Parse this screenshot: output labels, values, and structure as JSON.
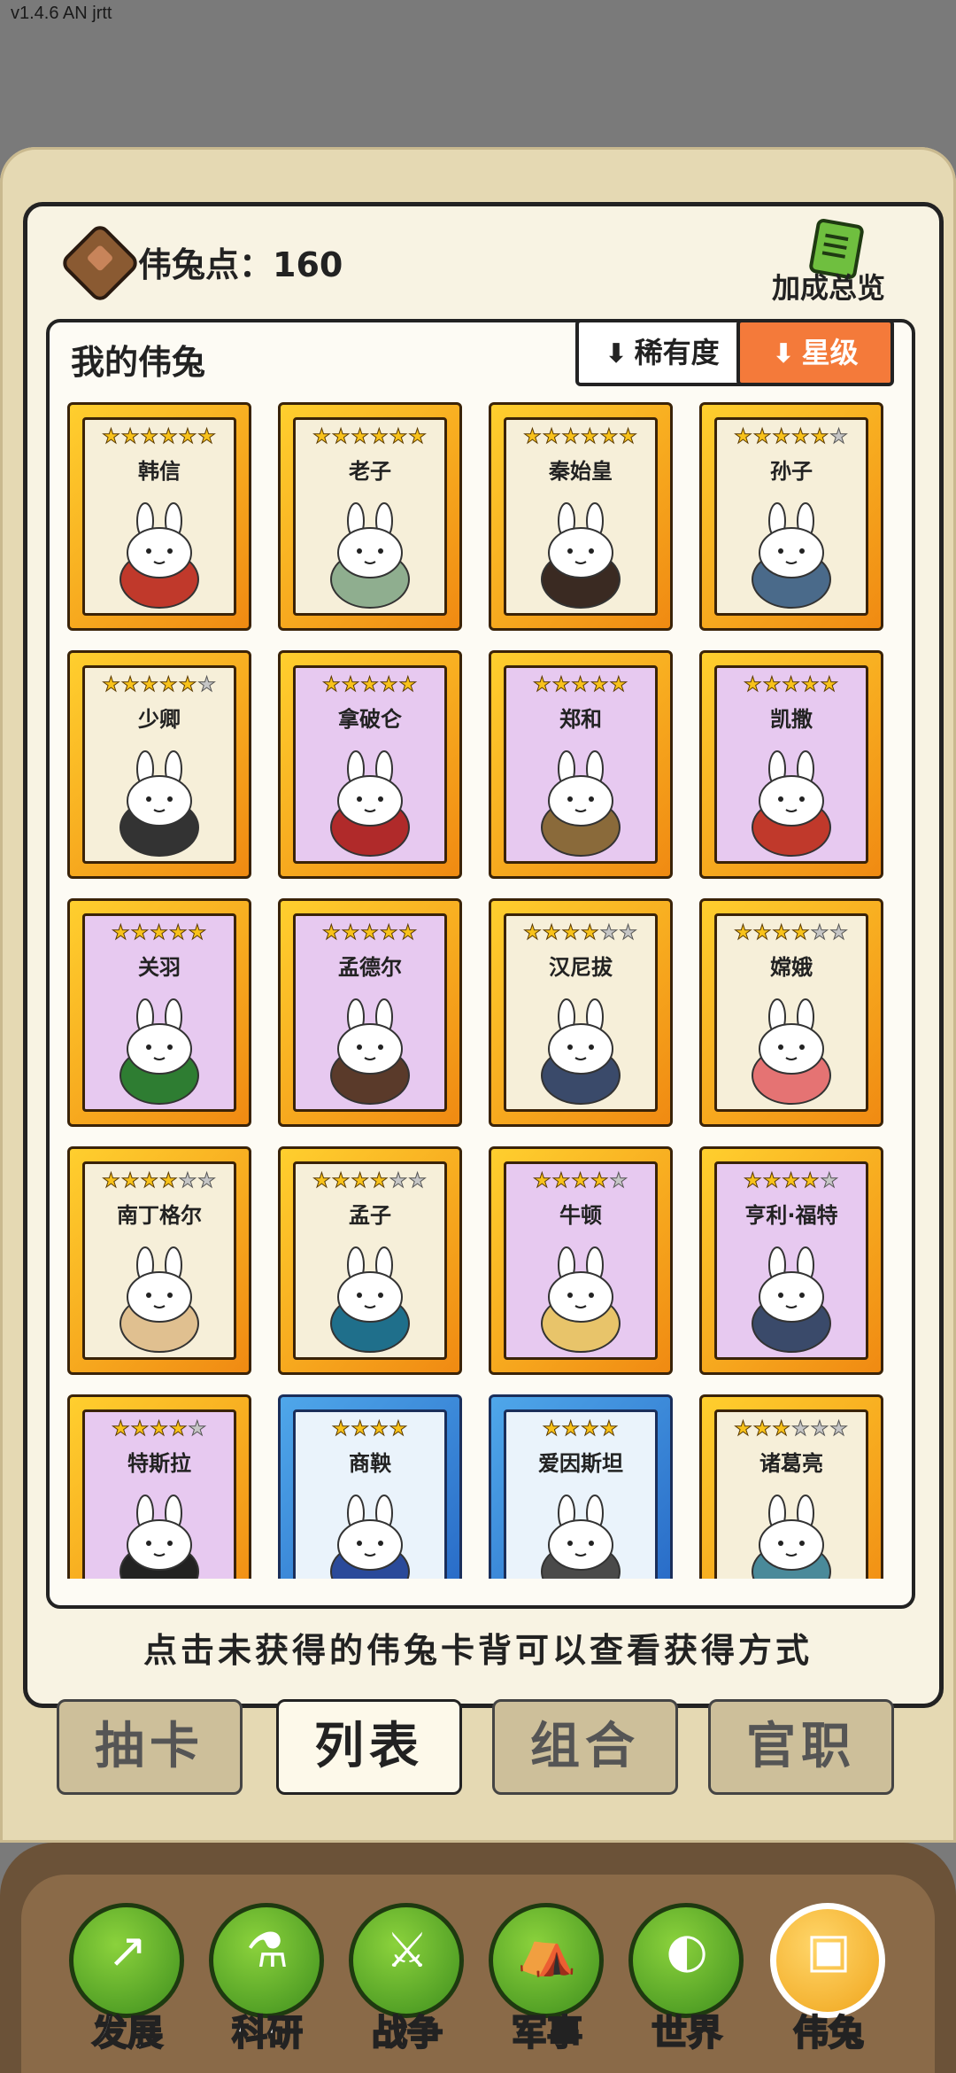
{
  "version": "v1.4.6 AN jrtt",
  "header": {
    "points_label": "伟兔点：160",
    "bonus_label": "加成总览"
  },
  "section_title": "我的伟兔",
  "sort": {
    "rarity": "稀有度",
    "star": "星级"
  },
  "cards": [
    {
      "name": "韩信",
      "stars": 6,
      "max": 6,
      "bg": "cream",
      "color": "#c0392b"
    },
    {
      "name": "老子",
      "stars": 6,
      "max": 6,
      "bg": "cream",
      "color": "#8fae8f"
    },
    {
      "name": "秦始皇",
      "stars": 6,
      "max": 6,
      "bg": "cream",
      "color": "#3a2a22"
    },
    {
      "name": "孙子",
      "stars": 5,
      "max": 6,
      "bg": "cream",
      "color": "#4a6a8a"
    },
    {
      "name": "少卿",
      "stars": 5,
      "max": 6,
      "bg": "cream",
      "color": "#333333"
    },
    {
      "name": "拿破仑",
      "stars": 5,
      "max": 5,
      "bg": "purple",
      "color": "#b02a2a"
    },
    {
      "name": "郑和",
      "stars": 5,
      "max": 5,
      "bg": "purple",
      "color": "#8a6a3a"
    },
    {
      "name": "凯撒",
      "stars": 5,
      "max": 5,
      "bg": "purple",
      "color": "#c0392b"
    },
    {
      "name": "关羽",
      "stars": 5,
      "max": 5,
      "bg": "purple",
      "color": "#2e7d32"
    },
    {
      "name": "孟德尔",
      "stars": 5,
      "max": 5,
      "bg": "purple",
      "color": "#5a3a2a"
    },
    {
      "name": "汉尼拔",
      "stars": 4,
      "max": 6,
      "bg": "cream",
      "color": "#3a4a6a"
    },
    {
      "name": "嫦娥",
      "stars": 4,
      "max": 6,
      "bg": "cream",
      "color": "#e57373"
    },
    {
      "name": "南丁格尔",
      "stars": 4,
      "max": 6,
      "bg": "cream",
      "color": "#e0c090"
    },
    {
      "name": "孟子",
      "stars": 4,
      "max": 6,
      "bg": "cream",
      "color": "#1f6f8b"
    },
    {
      "name": "牛顿",
      "stars": 4,
      "max": 5,
      "bg": "purple",
      "color": "#e8c46a"
    },
    {
      "name": "亨利·福特",
      "stars": 4,
      "max": 5,
      "bg": "purple",
      "color": "#3a4a6a"
    },
    {
      "name": "特斯拉",
      "stars": 4,
      "max": 5,
      "bg": "purple",
      "color": "#222222"
    },
    {
      "name": "商鞅",
      "stars": 4,
      "max": 4,
      "bg": "blue",
      "color": "#2a4a9a"
    },
    {
      "name": "爱因斯坦",
      "stars": 4,
      "max": 4,
      "bg": "blue",
      "color": "#4a4a4a"
    },
    {
      "name": "诸葛亮",
      "stars": 3,
      "max": 6,
      "bg": "cream",
      "color": "#4a8a9a"
    }
  ],
  "hint": "点击未获得的伟兔卡背可以查看获得方式",
  "tabs": [
    "抽卡",
    "列表",
    "组合",
    "官职"
  ],
  "active_tab": "列表",
  "nav": [
    {
      "label": "发展",
      "glyph": "↗"
    },
    {
      "label": "科研",
      "glyph": "⚗"
    },
    {
      "label": "战争",
      "glyph": "⚔"
    },
    {
      "label": "军事",
      "glyph": "⛺"
    },
    {
      "label": "世界",
      "glyph": "◐"
    },
    {
      "label": "伟兔",
      "glyph": "▣"
    }
  ],
  "active_nav": "伟兔"
}
